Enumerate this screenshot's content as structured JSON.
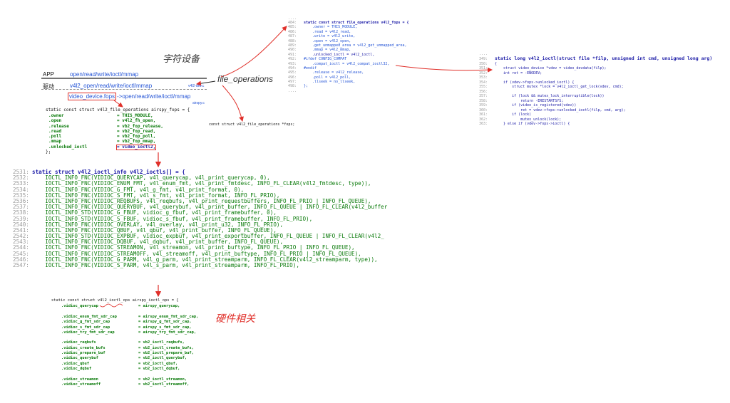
{
  "handwritten": {
    "char_device": "字符设备",
    "file_operations": "file_operations",
    "hardware_related": "硬件相关"
  },
  "layers": {
    "app": {
      "label": "APP",
      "ops": "open/read/write/ioctl/mmap"
    },
    "driver": {
      "label": "驱动",
      "ops": "v4l2_open/read/write/ioctl/mmap",
      "file": "v4l2-dev.c"
    },
    "device": {
      "fops": "video_device.fops",
      "ops": "->open/read/write/ioctl/mmap",
      "file": "airspy.c"
    }
  },
  "airspy_fops": {
    "header": "static const struct v4l2_file_operations airspy_fops = {",
    "rows": [
      {
        "field": ".owner",
        "value": "= THIS_MODULE,"
      },
      {
        "field": ".open",
        "value": "= v4l2_fh_open,"
      },
      {
        "field": ".release",
        "value": "= vb2_fop_release,"
      },
      {
        "field": ".read",
        "value": "= vb2_fop_read,"
      },
      {
        "field": ".poll",
        "value": "= vb2_fop_poll,"
      },
      {
        "field": ".mmap",
        "value": "= vb2_fop_mmap,"
      },
      {
        "field": ".unlocked_ioctl",
        "value": "= video_ioctl2,"
      }
    ],
    "footer": "};"
  },
  "mid_code": "const struct v4l2_file_operations *fops;",
  "v4l2_fops": {
    "lines": [
      {
        "no": "484:",
        "text": "static const struct file_operations v4l2_fops = {"
      },
      {
        "no": "485:",
        "text": "    .owner = THIS_MODULE,"
      },
      {
        "no": "486:",
        "text": "    .read = v4l2_read,"
      },
      {
        "no": "487:",
        "text": "    .write = v4l2_write,"
      },
      {
        "no": "488:",
        "text": "    .open = v4l2_open,"
      },
      {
        "no": "489:",
        "text": "    .get_unmapped_area = v4l2_get_unmapped_area,"
      },
      {
        "no": "490:",
        "text": "    .mmap = v4l2_mmap,"
      },
      {
        "no": "491:",
        "text": "    .unlocked_ioctl = v4l2_ioctl,"
      },
      {
        "no": "492:",
        "text": "#ifdef CONFIG_COMPAT"
      },
      {
        "no": "493:",
        "text": "    .compat_ioctl = v4l2_compat_ioctl32,"
      },
      {
        "no": "494:",
        "text": "#endif"
      },
      {
        "no": "495:",
        "text": "    .release = v4l2_release,"
      },
      {
        "no": "496:",
        "text": "    .poll = v4l2_poll,"
      },
      {
        "no": "497:",
        "text": "    .llseek = no_llseek,"
      },
      {
        "no": "498:",
        "text": "};"
      }
    ]
  },
  "v4l2_ioctl": {
    "lines": [
      {
        "no": "349:",
        "text": "static long v4l2_ioctl(struct file *filp, unsigned int cmd, unsigned long arg)"
      },
      {
        "no": "350:",
        "text": "{"
      },
      {
        "no": "351:",
        "text": "    struct video_device *vdev = video_devdata(filp);"
      },
      {
        "no": "352:",
        "text": "    int ret = -ENODEV;"
      },
      {
        "no": "353:",
        "text": ""
      },
      {
        "no": "354:",
        "text": "    if (vdev->fops->unlocked_ioctl) {"
      },
      {
        "no": "355:",
        "text": "        struct mutex *lock = v4l2_ioctl_get_lock(vdev, cmd);"
      },
      {
        "no": "356:",
        "text": ""
      },
      {
        "no": "357:",
        "text": "        if (lock && mutex_lock_interruptible(lock))"
      },
      {
        "no": "358:",
        "text": "            return -ERESTARTSYS;"
      },
      {
        "no": "359:",
        "text": "        if (video_is_registered(vdev))"
      },
      {
        "no": "360:",
        "text": "            ret = vdev->fops->unlocked_ioctl(filp, cmd, arg);"
      },
      {
        "no": "361:",
        "text": "        if (lock)"
      },
      {
        "no": "362:",
        "text": "            mutex_unlock(lock);"
      },
      {
        "no": "363:",
        "text": "    } else if (vdev->fops->ioctl) {"
      }
    ]
  },
  "ioctls": {
    "lines": [
      {
        "no": "2531:",
        "text": "static struct v4l2_ioctl_info v4l2_ioctls[] = {"
      },
      {
        "no": "2532:",
        "text": "    IOCTL_INFO_FNC(VIDIOC_QUERYCAP, v4l_querycap, v4l_print_querycap, 0),"
      },
      {
        "no": "2533:",
        "text": "    IOCTL_INFO_FNC(VIDIOC_ENUM_FMT, v4l_enum_fmt, v4l_print_fmtdesc, INFO_FL_CLEAR(v4l2_fmtdesc, type)),"
      },
      {
        "no": "2534:",
        "text": "    IOCTL_INFO_FNC(VIDIOC_G_FMT, v4l_g_fmt, v4l_print_format, 0),"
      },
      {
        "no": "2535:",
        "text": "    IOCTL_INFO_FNC(VIDIOC_S_FMT, v4l_s_fmt, v4l_print_format, INFO_FL_PRIO),"
      },
      {
        "no": "2536:",
        "text": "    IOCTL_INFO_FNC(VIDIOC_REQBUFS, v4l_reqbufs, v4l_print_requestbuffers, INFO_FL_PRIO | INFO_FL_QUEUE),"
      },
      {
        "no": "2537:",
        "text": "    IOCTL_INFO_FNC(VIDIOC_QUERYBUF, v4l_querybuf, v4l_print_buffer, INFO_FL_QUEUE | INFO_FL_CLEAR(v4l2_buffer"
      },
      {
        "no": "2538:",
        "text": "    IOCTL_INFO_STD(VIDIOC_G_FBUF, vidioc_g_fbuf, v4l_print_framebuffer, 0),"
      },
      {
        "no": "2539:",
        "text": "    IOCTL_INFO_STD(VIDIOC_S_FBUF, vidioc_s_fbuf, v4l_print_framebuffer, INFO_FL_PRIO),"
      },
      {
        "no": "2540:",
        "text": "    IOCTL_INFO_FNC(VIDIOC_OVERLAY, v4l_overlay, v4l_print_u32, INFO_FL_PRIO),"
      },
      {
        "no": "2541:",
        "text": "    IOCTL_INFO_FNC(VIDIOC_QBUF, v4l_qbuf, v4l_print_buffer, INFO_FL_QUEUE),"
      },
      {
        "no": "2542:",
        "text": "    IOCTL_INFO_STD(VIDIOC_EXPBUF, vidioc_expbuf, v4l_print_exportbuffer, INFO_FL_QUEUE | INFO_FL_CLEAR(v4l2_"
      },
      {
        "no": "2543:",
        "text": "    IOCTL_INFO_FNC(VIDIOC_DQBUF, v4l_dqbuf, v4l_print_buffer, INFO_FL_QUEUE),"
      },
      {
        "no": "2544:",
        "text": "    IOCTL_INFO_FNC(VIDIOC_STREAMON, v4l_streamon, v4l_print_buftype, INFO_FL_PRIO | INFO_FL_QUEUE),"
      },
      {
        "no": "2545:",
        "text": "    IOCTL_INFO_FNC(VIDIOC_STREAMOFF, v4l_streamoff, v4l_print_buftype, INFO_FL_PRIO | INFO_FL_QUEUE),"
      },
      {
        "no": "2546:",
        "text": "    IOCTL_INFO_FNC(VIDIOC_G_PARM, v4l_g_parm, v4l_print_streamparm, INFO_FL_CLEAR(v4l2_streamparm, type)),"
      },
      {
        "no": "2547:",
        "text": "    IOCTL_INFO_FNC(VIDIOC_S_PARM, v4l_s_parm, v4l_print_streamparm, INFO_FL_PRIO),"
      }
    ]
  },
  "ioctl_ops": {
    "header": "static const struct v4l2_ioctl_ops airspy_ioctl_ops = {",
    "rows": [
      {
        "field": ".vidioc_querycap",
        "value": "= airspy_querycap,"
      },
      {
        "field": "",
        "value": ""
      },
      {
        "field": ".vidioc_enum_fmt_sdr_cap",
        "value": "= airspy_enum_fmt_sdr_cap,"
      },
      {
        "field": ".vidioc_g_fmt_sdr_cap",
        "value": "= airspy_g_fmt_sdr_cap,"
      },
      {
        "field": ".vidioc_s_fmt_sdr_cap",
        "value": "= airspy_s_fmt_sdr_cap,"
      },
      {
        "field": ".vidioc_try_fmt_sdr_cap",
        "value": "= airspy_try_fmt_sdr_cap,"
      },
      {
        "field": "",
        "value": ""
      },
      {
        "field": ".vidioc_reqbufs",
        "value": "= vb2_ioctl_reqbufs,"
      },
      {
        "field": ".vidioc_create_bufs",
        "value": "= vb2_ioctl_create_bufs,"
      },
      {
        "field": ".vidioc_prepare_buf",
        "value": "= vb2_ioctl_prepare_buf,"
      },
      {
        "field": ".vidioc_querybuf",
        "value": "= vb2_ioctl_querybuf,"
      },
      {
        "field": ".vidioc_qbuf",
        "value": "= vb2_ioctl_qbuf,"
      },
      {
        "field": ".vidioc_dqbuf",
        "value": "= vb2_ioctl_dqbuf,"
      },
      {
        "field": "",
        "value": ""
      },
      {
        "field": ".vidioc_streamon",
        "value": "= vb2_ioctl_streamon,"
      },
      {
        "field": ".vidioc_streamoff",
        "value": "= vb2_ioctl_streamoff,"
      }
    ]
  },
  "colors": {
    "annotation": "#e0302a",
    "link": "#2454d6",
    "keyword": "#1a1aa6"
  }
}
